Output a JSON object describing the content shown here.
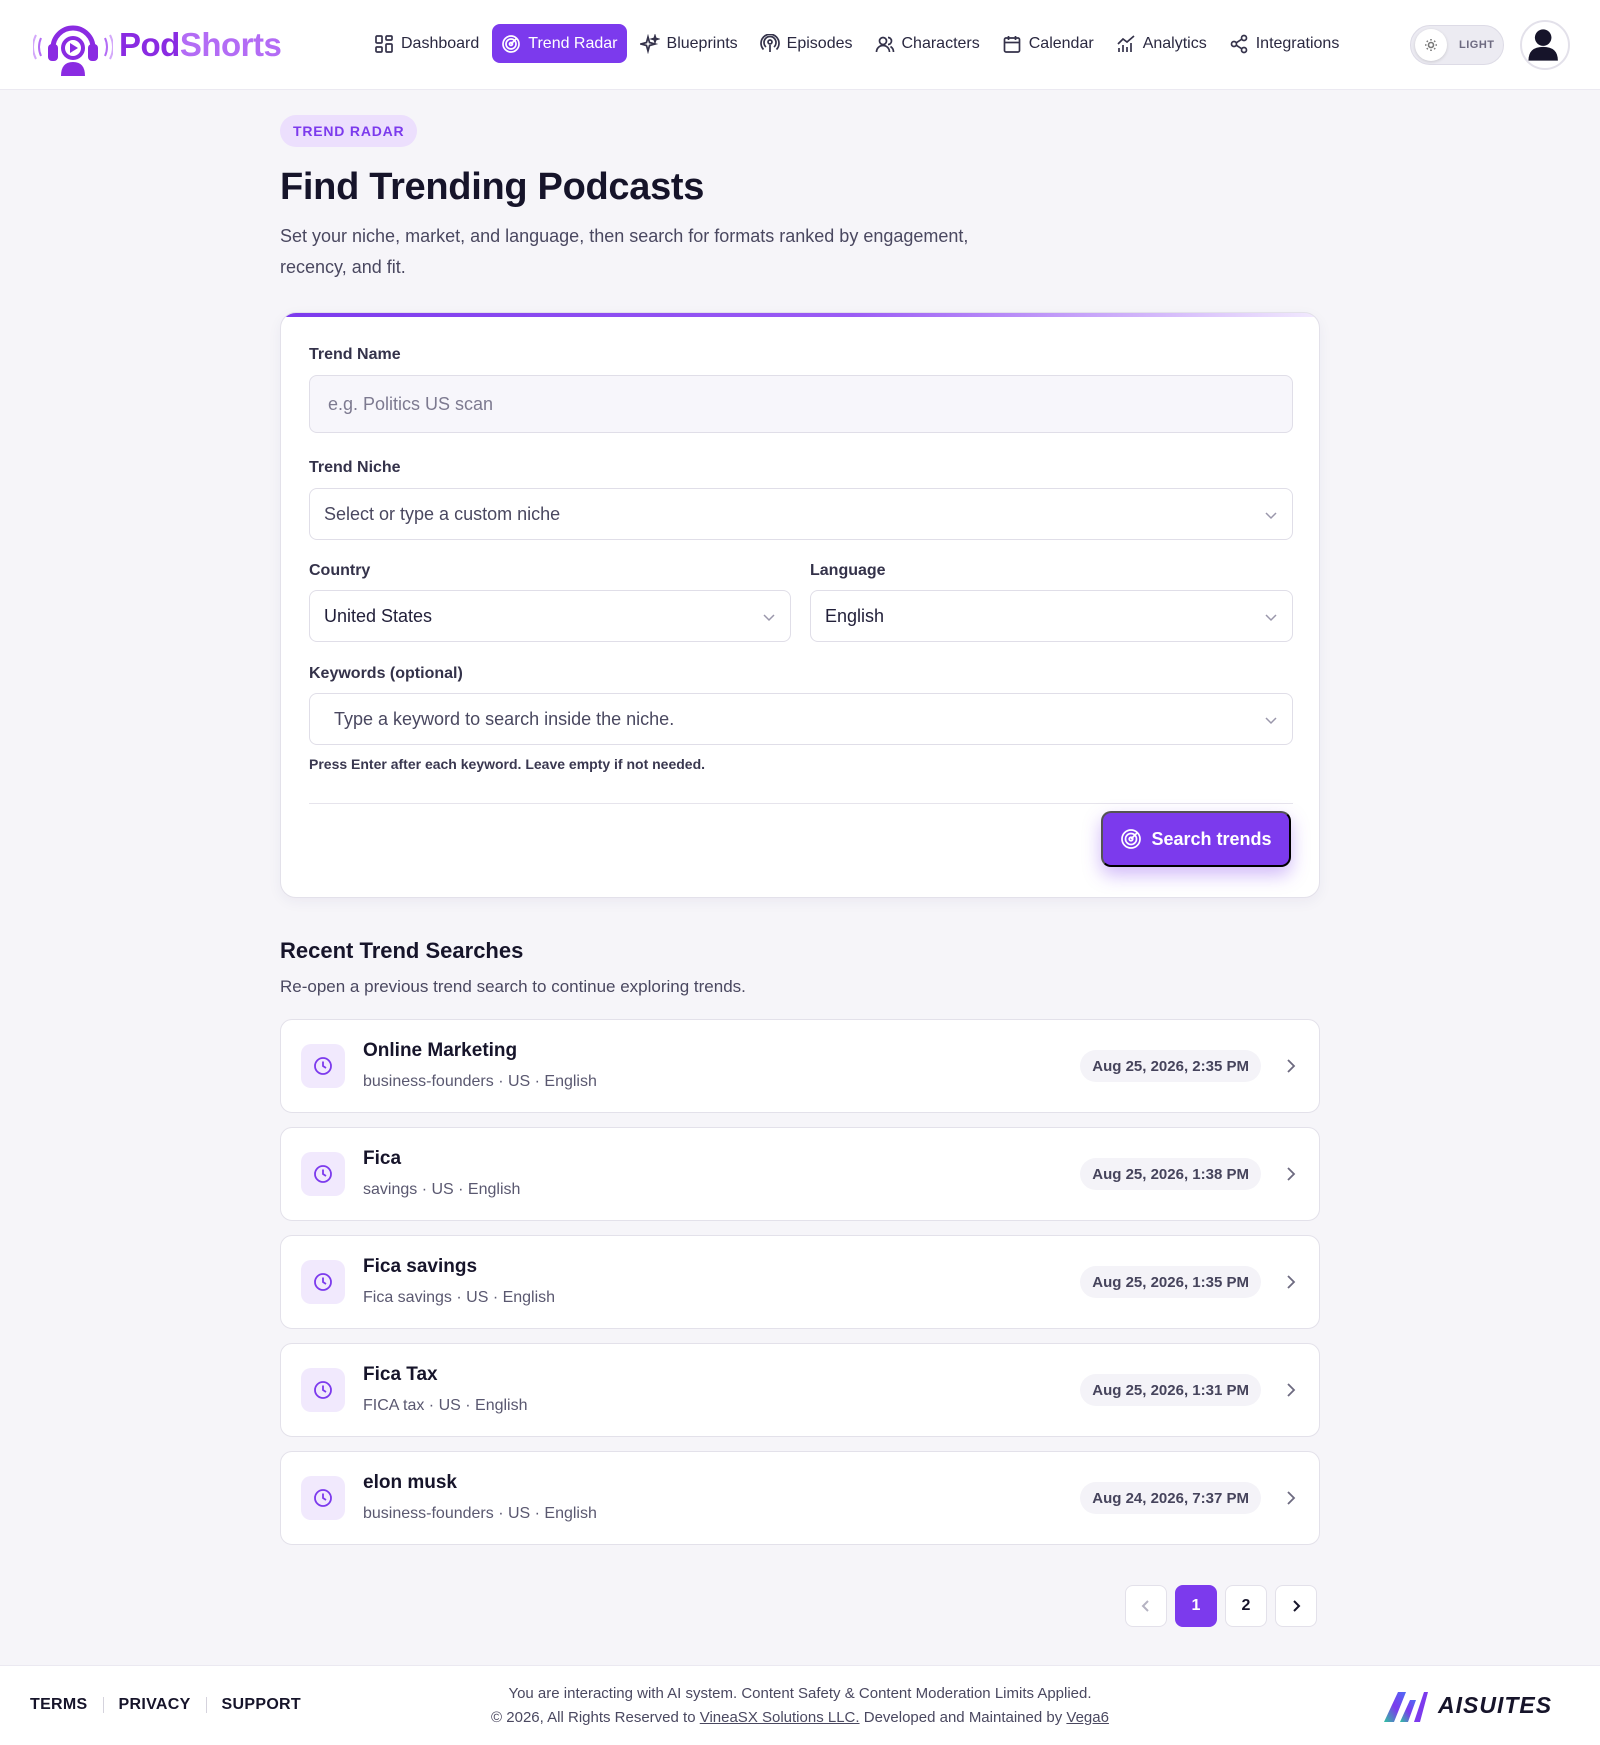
{
  "app": {
    "brand_part1": "Pod",
    "brand_part2": "Shorts",
    "brand_colors": {
      "primary": "#8a2be2",
      "secondary": "#b36cf5"
    }
  },
  "nav": {
    "items": [
      {
        "label": "Dashboard",
        "icon": "grid-icon"
      },
      {
        "label": "Trend Radar",
        "icon": "radar-icon",
        "active": true
      },
      {
        "label": "Blueprints",
        "icon": "sparkles-icon"
      },
      {
        "label": "Episodes",
        "icon": "podcast-icon"
      },
      {
        "label": "Characters",
        "icon": "users-icon"
      },
      {
        "label": "Calendar",
        "icon": "calendar-icon"
      },
      {
        "label": "Analytics",
        "icon": "chart-icon"
      },
      {
        "label": "Integrations",
        "icon": "share-icon"
      }
    ],
    "theme_label": "LIGHT"
  },
  "page": {
    "pill": "TREND RADAR",
    "title": "Find Trending Podcasts",
    "subtitle": "Set your niche, market, and language, then search for formats ranked by engagement, recency, and fit."
  },
  "form": {
    "trend_name_label": "Trend Name",
    "trend_name_placeholder": "e.g. Politics US scan",
    "niche_label": "Trend Niche",
    "niche_placeholder": "Select or type a custom niche",
    "country_label": "Country",
    "country_value": "United States",
    "language_label": "Language",
    "language_value": "English",
    "keywords_label": "Keywords (optional)",
    "keywords_placeholder": "Type a keyword to search inside the niche.",
    "hint": "Press Enter after each keyword. Leave empty if not needed.",
    "submit_label": "Search trends",
    "accent_color": "#7c3aed"
  },
  "recent": {
    "title": "Recent Trend Searches",
    "subtitle": "Re-open a previous trend search to continue exploring trends.",
    "items": [
      {
        "name": "Online Marketing",
        "meta": "business-founders · US · English",
        "date": "Aug 25, 2026, 2:35 PM"
      },
      {
        "name": "Fica",
        "meta": "savings · US · English",
        "date": "Aug 25, 2026, 1:38 PM"
      },
      {
        "name": "Fica savings",
        "meta": "Fica savings · US · English",
        "date": "Aug 25, 2026, 1:35 PM"
      },
      {
        "name": "Fica Tax",
        "meta": "FICA tax · US · English",
        "date": "Aug 25, 2026, 1:31 PM"
      },
      {
        "name": "elon musk",
        "meta": "business-founders · US · English",
        "date": "Aug 24, 2026, 7:37 PM"
      }
    ]
  },
  "pagination": {
    "pages": [
      "1",
      "2"
    ],
    "current": "1"
  },
  "footer": {
    "links": [
      "TERMS",
      "PRIVACY",
      "SUPPORT"
    ],
    "notice": "You are interacting with AI system. Content Safety & Content Moderation Limits Applied.",
    "copyright_prefix": "© 2026, All Rights Reserved to",
    "company": "VineaSX Solutions LLC.",
    "maintained_prefix": "Developed and Maintained by",
    "maintainer": "Vega6",
    "brand": "AISUITES"
  }
}
